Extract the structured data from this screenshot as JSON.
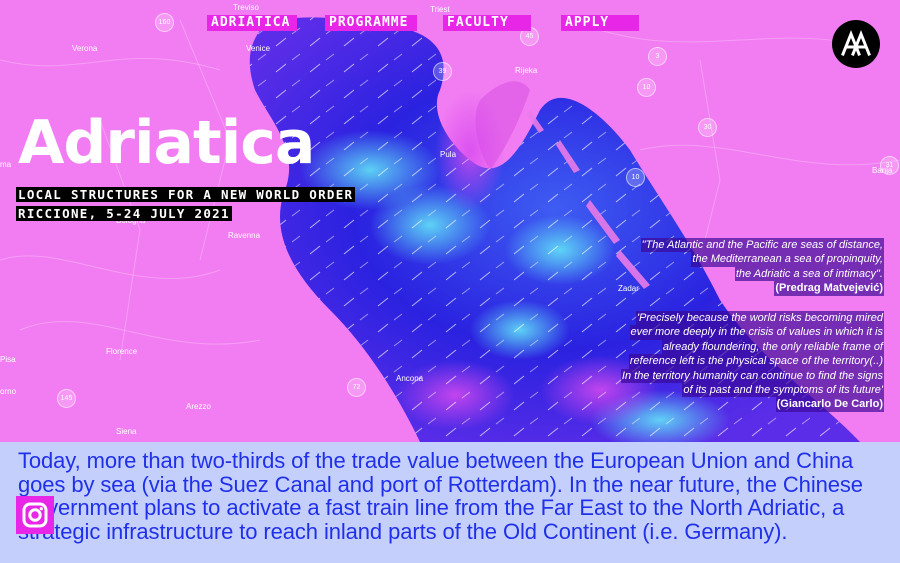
{
  "nav": {
    "items": [
      "ADRIATICA",
      "PROGRAMME",
      "FACULTY",
      "APPLY"
    ]
  },
  "logo": {
    "icon": "aa-logo-icon",
    "text": "AA"
  },
  "hero": {
    "title": "Adriatica",
    "subtitle": "LOCAL STRUCTURES FOR A NEW WORLD ORDER",
    "dates": "RICCIONE, 5-24 JULY 2021"
  },
  "map": {
    "places": [
      "Treviso",
      "Verona",
      "Venice",
      "Triest",
      "Rijeka",
      "Pula",
      "Bologna",
      "Ravenna",
      "Florence",
      "Ancona",
      "Arezzo",
      "Siena",
      "Zadar",
      "Banja",
      "Pisa",
      "orno",
      "ma"
    ],
    "road_numbers": [
      "160",
      "39",
      "45",
      "3",
      "10",
      "10",
      "30",
      "31",
      "72",
      "145"
    ]
  },
  "quotes": [
    {
      "lines": [
        "\"The Atlantic and the Pacific are seas of distance,",
        "the Mediterranean a sea of propinquity,",
        "the Adriatic a sea of intimacy\"."
      ],
      "author": "(Predrag Matvejević)"
    },
    {
      "lines": [
        "'Precisely because the world risks becoming mired",
        "ever more deeply in the crisis of values in which it is",
        "already floundering, the only reliable frame of",
        "reference left is the physical space of the territory(..)",
        "In the territory humanity can continue to find the signs",
        "of its past and the symptoms of its future'"
      ],
      "author": "(Giancarlo De Carlo)"
    }
  ],
  "intro": {
    "text": "Today, more than two-thirds of the trade value between the European Union and China goes by sea (via the Suez Canal and port of Rotterdam). In the near future, the Chinese Government plans to activate a fast train line from the Far East to the North Adriatic, a strategic infrastructure to reach inland parts of the Old Continent (i.e. Germany)."
  },
  "social": {
    "icon": "instagram-icon"
  },
  "colors": {
    "land": "#f27df2",
    "sea_deep": "#2a1fe0",
    "sea_light": "#4fd3f5",
    "nav_bg": "#e826e8",
    "body_bg": "#c4d0fb",
    "body_text": "#2030ea"
  }
}
